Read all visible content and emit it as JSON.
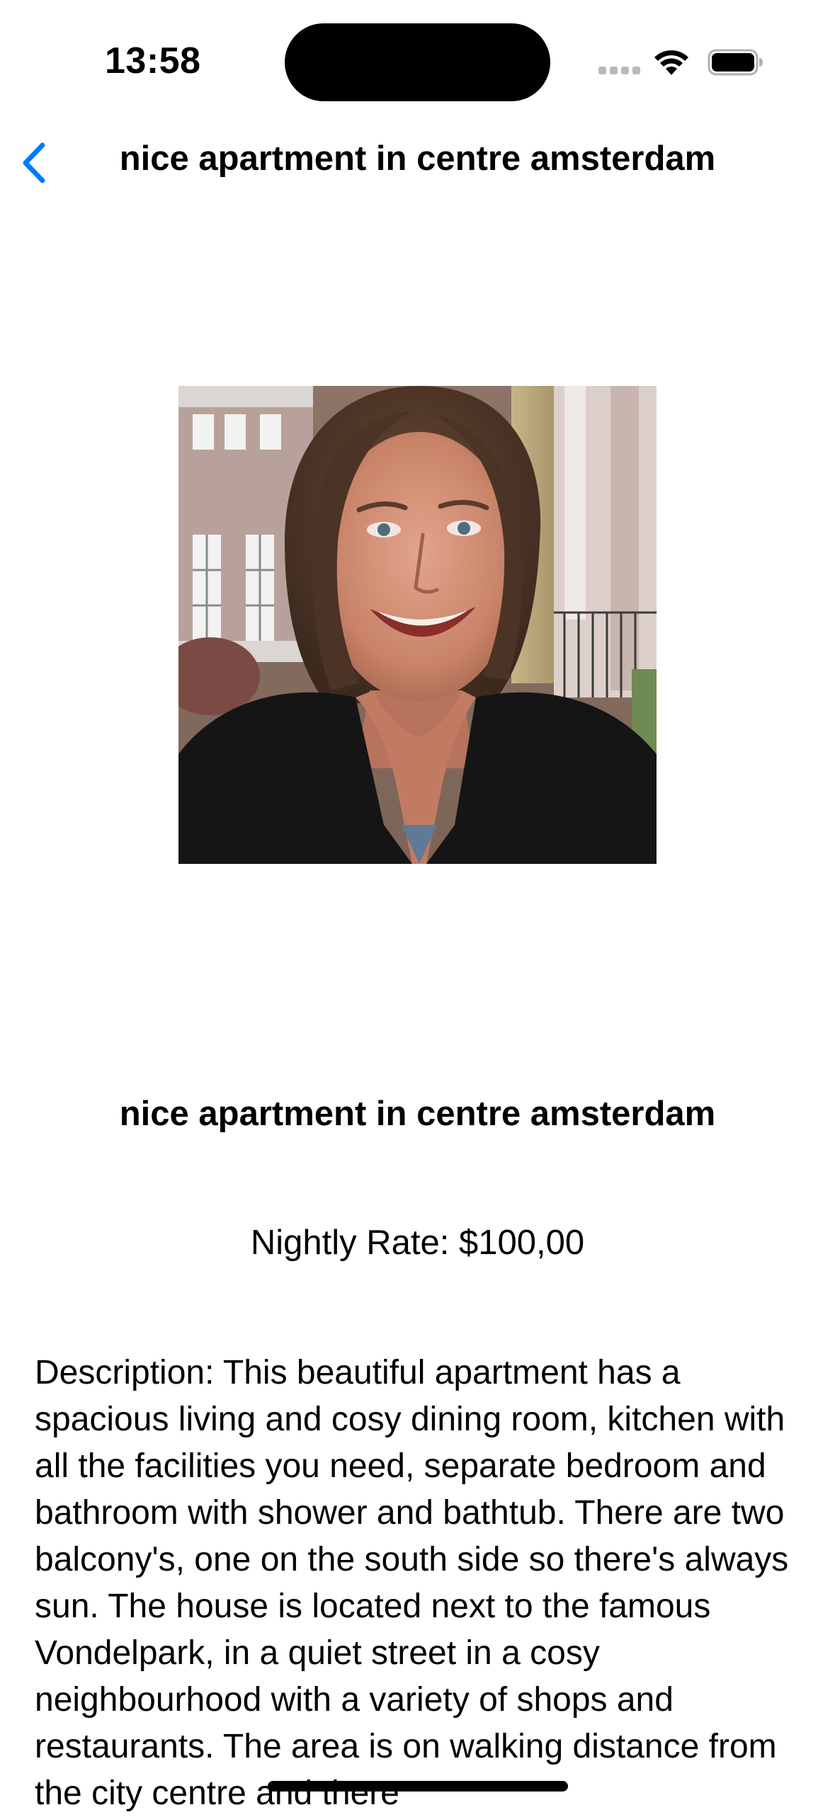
{
  "status_bar": {
    "time": "13:58",
    "signal_icon": "cellular-signal-icon",
    "wifi_icon": "wifi-icon",
    "battery_icon": "battery-icon"
  },
  "nav": {
    "back_icon": "chevron-left-icon",
    "title": "nice apartment in centre amsterdam",
    "accent_color": "#007AFF"
  },
  "listing": {
    "title": "nice apartment in centre amsterdam",
    "nightly_rate": "Nightly Rate: $100,00",
    "description": "Description: This beautiful apartment has a spacious living and cosy dining room, kitchen with all the facilities you need, separate bedroom and bathroom with shower and bathtub. There are two balcony's, one on the south side so there's always sun.  The house is located next to the famous Vondelpark, in a quiet street in a cosy neighbourhood with a variety of shops and restaurants. The area is on walking distance from the city centre and there"
  }
}
